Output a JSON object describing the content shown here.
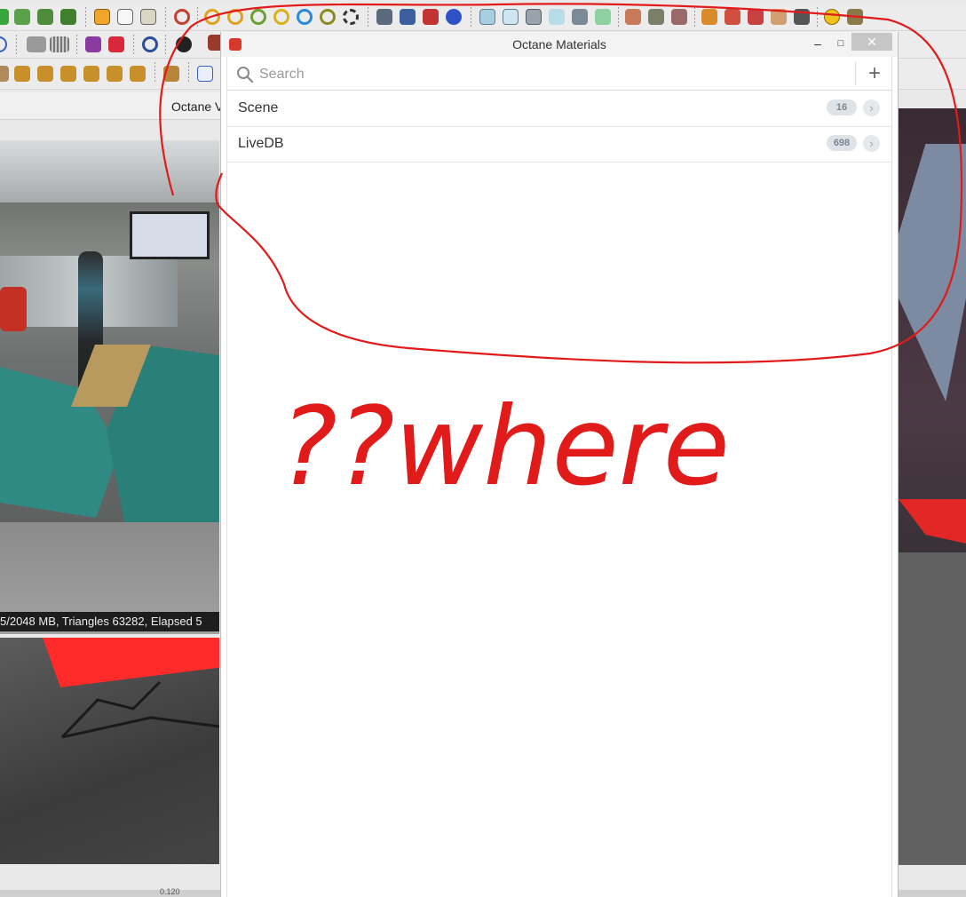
{
  "colors": {
    "annotation": "#e11a1a",
    "badge_bg": "#dfe3e8",
    "badge_text": "#7a8591",
    "panel_bg": "#ffffff",
    "titlebar_bg": "#f3f3f3",
    "close_bg": "#c7c7c7"
  },
  "toolbars": {
    "row1_icons": [
      "green-arrow-icon",
      "plant-icon",
      "tree-icon",
      "shrub-icon",
      "box-icon",
      "cube-icon",
      "cube-3d-icon",
      "rotate-icon",
      "follow-me-icon",
      "push-pull-icon",
      "arc-icon",
      "offset-icon",
      "circle-icon",
      "orbit-icon",
      "layers-icon",
      "layers-blue-icon",
      "layers-red-icon",
      "sphere-icon",
      "solid-icon",
      "solid-outline-icon",
      "shell-icon",
      "paint-icon",
      "tape-icon",
      "section-icon",
      "section-plane-icon",
      "dimension-icon",
      "dimension-red-icon",
      "text-icon",
      "axes-icon",
      "tools-icon",
      "compass-icon",
      "wrench-icon"
    ],
    "row2_icons": [
      "paint-bucket-icon",
      "grid-icon",
      "grid-dots-icon",
      "link-icon",
      "link-red-icon",
      "target-icon",
      "gear-icon",
      "book-icon"
    ],
    "row3_icons": [
      "layer-icon",
      "arrow-j-icon",
      "arrow-r-icon",
      "arrow-v-icon",
      "arrow-n-icon",
      "arrow-x-icon",
      "arrow-f-icon",
      "move-icon",
      "fe-icon"
    ]
  },
  "left_viewport": {
    "tab_label": "Octane V",
    "status_text": "5/2048 MB, Triangles 63282, Elapsed 5"
  },
  "bottom_bar": {
    "value": "0.120"
  },
  "materials_panel": {
    "title": "Octane Materials",
    "minimize_label": "–",
    "maximize_label": "□",
    "close_label": "✕",
    "search": {
      "placeholder": "Search",
      "value": ""
    },
    "add_label": "+",
    "rows": [
      {
        "label": "Scene",
        "count": "16"
      },
      {
        "label": "LiveDB",
        "count": "698"
      }
    ]
  },
  "annotation": {
    "text": "??where"
  }
}
